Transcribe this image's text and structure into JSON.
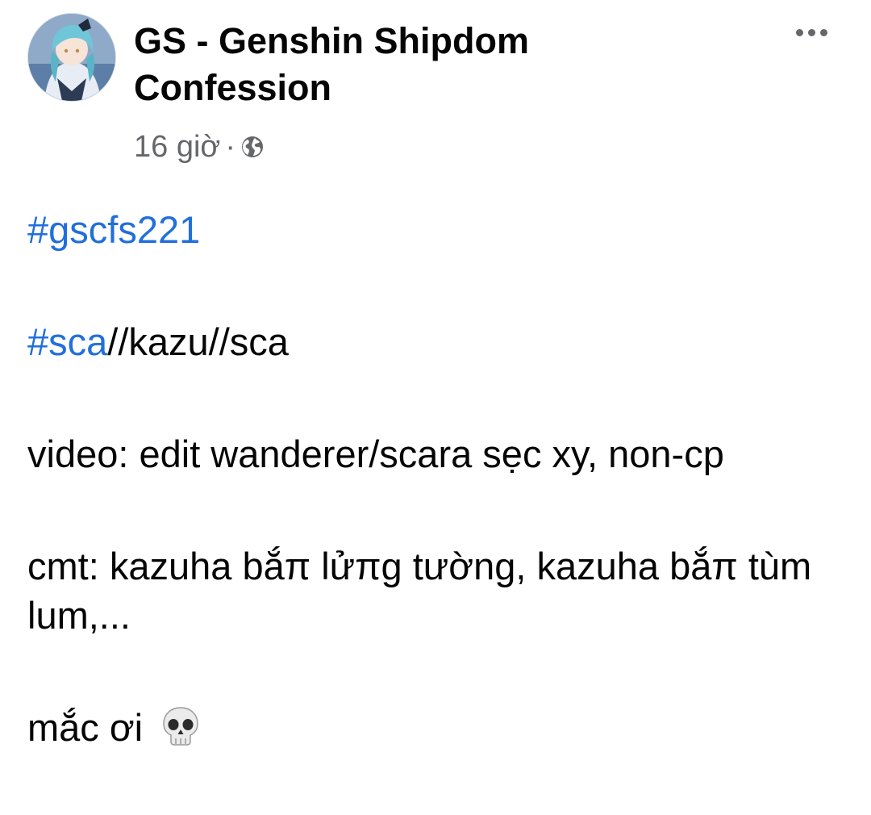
{
  "post": {
    "page_name": "GS - Genshin Shipdom Confession",
    "time_ago": "16 giờ",
    "meta_separator": "·",
    "privacy_icon": "globe-icon",
    "more_icon": "more-horizontal-icon",
    "avatar_icon": "page-avatar",
    "colors": {
      "hashtag": "#216fdb",
      "meta_text": "#65676b",
      "body_text": "#050505"
    },
    "body": {
      "hashtag_1": "#gscfs221",
      "line2_hashtag": "#sca",
      "line2_rest": "//kazu//sca",
      "line3": "video: edit wanderer/scara sẹc xy, non-cp",
      "line4": "cmt: kazuha bắπ lửπg tường, kazuha bắπ tùm lum,...",
      "line5_text": "mắc ơi",
      "line5_emoji": "skull-icon"
    }
  }
}
